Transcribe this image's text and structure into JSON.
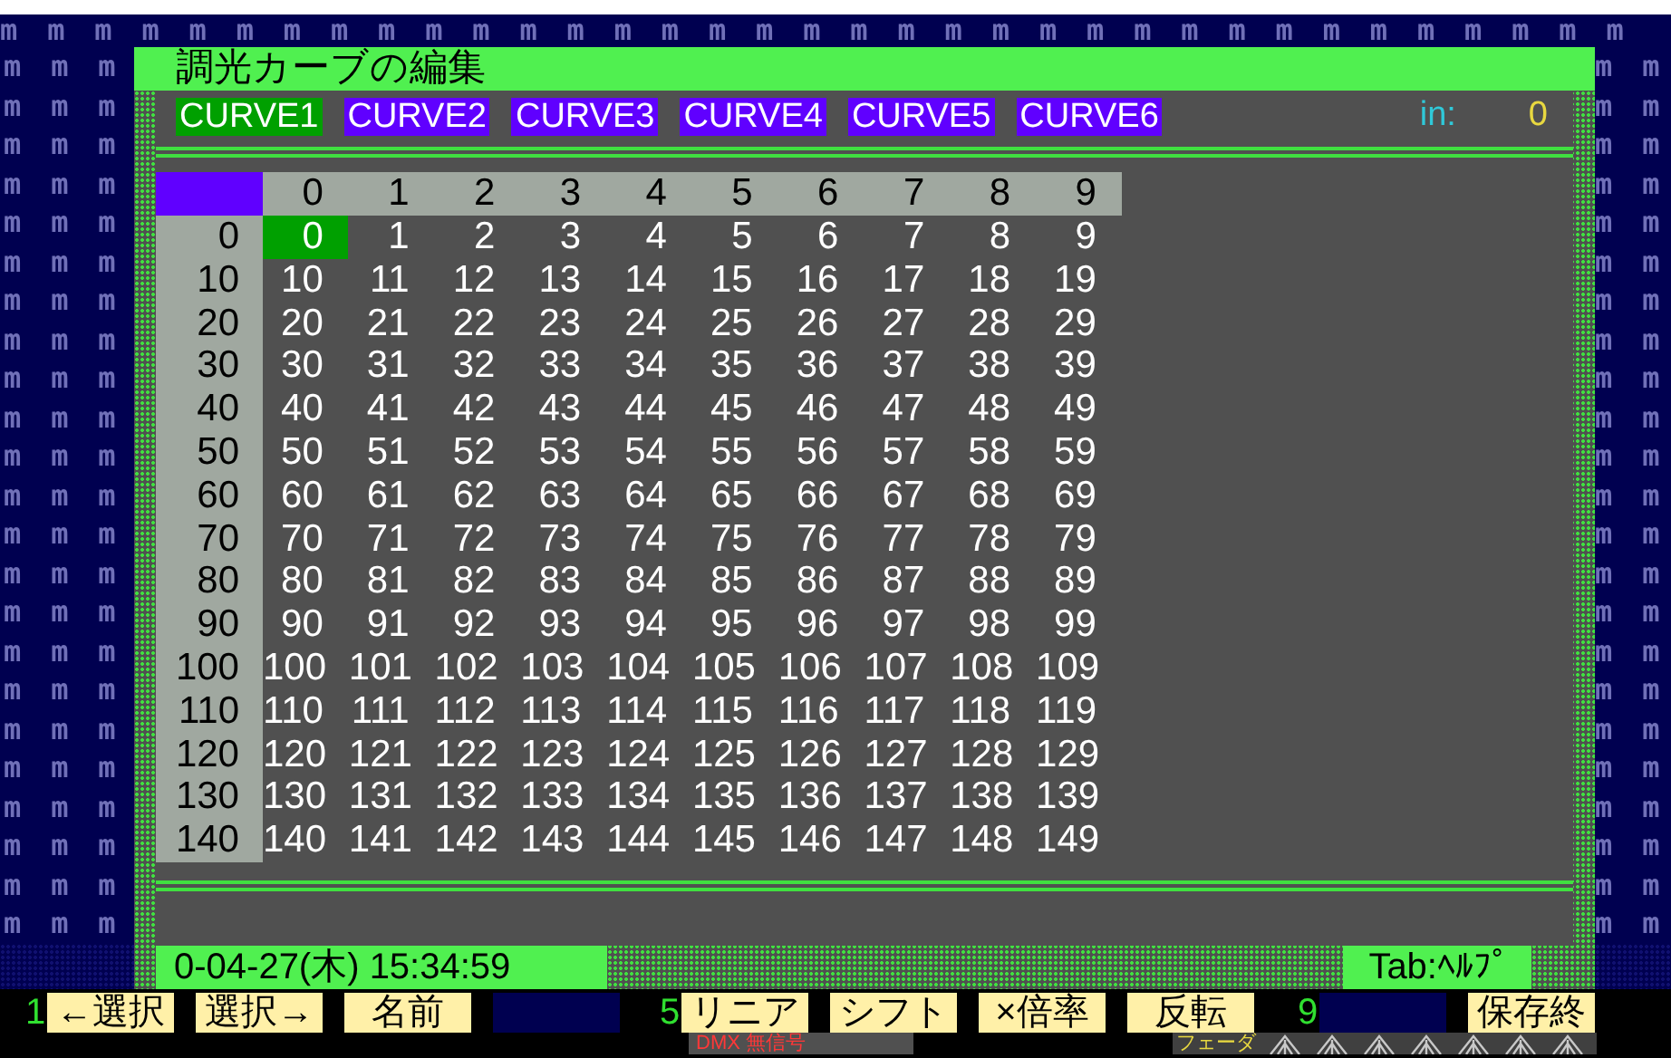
{
  "backdrop": {
    "top_row": "m m m m m m m m m m m m m m m m m m m m m m m m m m m m m m m m m m m",
    "left_rows": [
      "m m m",
      "m m m",
      "m m m",
      "m m m",
      "m m m",
      "m m m",
      "m m m",
      "m m m",
      "m m m",
      "m m m",
      "m m m",
      "m m m",
      "m m m",
      "m m m",
      "m m m",
      "m m m",
      "m m m",
      "m m m",
      "m m m",
      "m m m",
      "m m m",
      "m m m",
      "m m m"
    ],
    "right_rows": [
      "m m",
      "m m",
      "m m",
      "m m",
      "m m",
      "m m",
      "m m",
      "m m",
      "m m",
      "m m",
      "m m",
      "m m",
      "m m",
      "m m",
      "m m",
      "m m",
      "m m",
      "m m",
      "m m",
      "m m",
      "m m",
      "m m",
      "m m"
    ]
  },
  "window": {
    "title": "調光カーブの編集"
  },
  "curves": [
    {
      "label": "CURVE1",
      "selected": true
    },
    {
      "label": "CURVE2",
      "selected": false
    },
    {
      "label": "CURVE3",
      "selected": false
    },
    {
      "label": "CURVE4",
      "selected": false
    },
    {
      "label": "CURVE5",
      "selected": false
    },
    {
      "label": "CURVE6",
      "selected": false
    }
  ],
  "input": {
    "label": "in:",
    "value": "0"
  },
  "table": {
    "columns": [
      "0",
      "1",
      "2",
      "3",
      "4",
      "5",
      "6",
      "7",
      "8",
      "9"
    ],
    "rows": [
      {
        "header": "0",
        "cells": [
          {
            "value": "0",
            "selected": true
          },
          {
            "value": "1",
            "selected": false
          },
          {
            "value": "2",
            "selected": false
          },
          {
            "value": "3",
            "selected": false
          },
          {
            "value": "4",
            "selected": false
          },
          {
            "value": "5",
            "selected": false
          },
          {
            "value": "6",
            "selected": false
          },
          {
            "value": "7",
            "selected": false
          },
          {
            "value": "8",
            "selected": false
          },
          {
            "value": "9",
            "selected": false
          }
        ]
      },
      {
        "header": "10",
        "cells": [
          {
            "value": "10",
            "selected": false
          },
          {
            "value": "11",
            "selected": false
          },
          {
            "value": "12",
            "selected": false
          },
          {
            "value": "13",
            "selected": false
          },
          {
            "value": "14",
            "selected": false
          },
          {
            "value": "15",
            "selected": false
          },
          {
            "value": "16",
            "selected": false
          },
          {
            "value": "17",
            "selected": false
          },
          {
            "value": "18",
            "selected": false
          },
          {
            "value": "19",
            "selected": false
          }
        ]
      },
      {
        "header": "20",
        "cells": [
          {
            "value": "20",
            "selected": false
          },
          {
            "value": "21",
            "selected": false
          },
          {
            "value": "22",
            "selected": false
          },
          {
            "value": "23",
            "selected": false
          },
          {
            "value": "24",
            "selected": false
          },
          {
            "value": "25",
            "selected": false
          },
          {
            "value": "26",
            "selected": false
          },
          {
            "value": "27",
            "selected": false
          },
          {
            "value": "28",
            "selected": false
          },
          {
            "value": "29",
            "selected": false
          }
        ]
      },
      {
        "header": "30",
        "cells": [
          {
            "value": "30",
            "selected": false
          },
          {
            "value": "31",
            "selected": false
          },
          {
            "value": "32",
            "selected": false
          },
          {
            "value": "33",
            "selected": false
          },
          {
            "value": "34",
            "selected": false
          },
          {
            "value": "35",
            "selected": false
          },
          {
            "value": "36",
            "selected": false
          },
          {
            "value": "37",
            "selected": false
          },
          {
            "value": "38",
            "selected": false
          },
          {
            "value": "39",
            "selected": false
          }
        ]
      },
      {
        "header": "40",
        "cells": [
          {
            "value": "40",
            "selected": false
          },
          {
            "value": "41",
            "selected": false
          },
          {
            "value": "42",
            "selected": false
          },
          {
            "value": "43",
            "selected": false
          },
          {
            "value": "44",
            "selected": false
          },
          {
            "value": "45",
            "selected": false
          },
          {
            "value": "46",
            "selected": false
          },
          {
            "value": "47",
            "selected": false
          },
          {
            "value": "48",
            "selected": false
          },
          {
            "value": "49",
            "selected": false
          }
        ]
      },
      {
        "header": "50",
        "cells": [
          {
            "value": "50",
            "selected": false
          },
          {
            "value": "51",
            "selected": false
          },
          {
            "value": "52",
            "selected": false
          },
          {
            "value": "53",
            "selected": false
          },
          {
            "value": "54",
            "selected": false
          },
          {
            "value": "55",
            "selected": false
          },
          {
            "value": "56",
            "selected": false
          },
          {
            "value": "57",
            "selected": false
          },
          {
            "value": "58",
            "selected": false
          },
          {
            "value": "59",
            "selected": false
          }
        ]
      },
      {
        "header": "60",
        "cells": [
          {
            "value": "60",
            "selected": false
          },
          {
            "value": "61",
            "selected": false
          },
          {
            "value": "62",
            "selected": false
          },
          {
            "value": "63",
            "selected": false
          },
          {
            "value": "64",
            "selected": false
          },
          {
            "value": "65",
            "selected": false
          },
          {
            "value": "66",
            "selected": false
          },
          {
            "value": "67",
            "selected": false
          },
          {
            "value": "68",
            "selected": false
          },
          {
            "value": "69",
            "selected": false
          }
        ]
      },
      {
        "header": "70",
        "cells": [
          {
            "value": "70",
            "selected": false
          },
          {
            "value": "71",
            "selected": false
          },
          {
            "value": "72",
            "selected": false
          },
          {
            "value": "73",
            "selected": false
          },
          {
            "value": "74",
            "selected": false
          },
          {
            "value": "75",
            "selected": false
          },
          {
            "value": "76",
            "selected": false
          },
          {
            "value": "77",
            "selected": false
          },
          {
            "value": "78",
            "selected": false
          },
          {
            "value": "79",
            "selected": false
          }
        ]
      },
      {
        "header": "80",
        "cells": [
          {
            "value": "80",
            "selected": false
          },
          {
            "value": "81",
            "selected": false
          },
          {
            "value": "82",
            "selected": false
          },
          {
            "value": "83",
            "selected": false
          },
          {
            "value": "84",
            "selected": false
          },
          {
            "value": "85",
            "selected": false
          },
          {
            "value": "86",
            "selected": false
          },
          {
            "value": "87",
            "selected": false
          },
          {
            "value": "88",
            "selected": false
          },
          {
            "value": "89",
            "selected": false
          }
        ]
      },
      {
        "header": "90",
        "cells": [
          {
            "value": "90",
            "selected": false
          },
          {
            "value": "91",
            "selected": false
          },
          {
            "value": "92",
            "selected": false
          },
          {
            "value": "93",
            "selected": false
          },
          {
            "value": "94",
            "selected": false
          },
          {
            "value": "95",
            "selected": false
          },
          {
            "value": "96",
            "selected": false
          },
          {
            "value": "97",
            "selected": false
          },
          {
            "value": "98",
            "selected": false
          },
          {
            "value": "99",
            "selected": false
          }
        ]
      },
      {
        "header": "100",
        "cells": [
          {
            "value": "100",
            "selected": false
          },
          {
            "value": "101",
            "selected": false
          },
          {
            "value": "102",
            "selected": false
          },
          {
            "value": "103",
            "selected": false
          },
          {
            "value": "104",
            "selected": false
          },
          {
            "value": "105",
            "selected": false
          },
          {
            "value": "106",
            "selected": false
          },
          {
            "value": "107",
            "selected": false
          },
          {
            "value": "108",
            "selected": false
          },
          {
            "value": "109",
            "selected": false
          }
        ]
      },
      {
        "header": "110",
        "cells": [
          {
            "value": "110",
            "selected": false
          },
          {
            "value": "111",
            "selected": false
          },
          {
            "value": "112",
            "selected": false
          },
          {
            "value": "113",
            "selected": false
          },
          {
            "value": "114",
            "selected": false
          },
          {
            "value": "115",
            "selected": false
          },
          {
            "value": "116",
            "selected": false
          },
          {
            "value": "117",
            "selected": false
          },
          {
            "value": "118",
            "selected": false
          },
          {
            "value": "119",
            "selected": false
          }
        ]
      },
      {
        "header": "120",
        "cells": [
          {
            "value": "120",
            "selected": false
          },
          {
            "value": "121",
            "selected": false
          },
          {
            "value": "122",
            "selected": false
          },
          {
            "value": "123",
            "selected": false
          },
          {
            "value": "124",
            "selected": false
          },
          {
            "value": "125",
            "selected": false
          },
          {
            "value": "126",
            "selected": false
          },
          {
            "value": "127",
            "selected": false
          },
          {
            "value": "128",
            "selected": false
          },
          {
            "value": "129",
            "selected": false
          }
        ]
      },
      {
        "header": "130",
        "cells": [
          {
            "value": "130",
            "selected": false
          },
          {
            "value": "131",
            "selected": false
          },
          {
            "value": "132",
            "selected": false
          },
          {
            "value": "133",
            "selected": false
          },
          {
            "value": "134",
            "selected": false
          },
          {
            "value": "135",
            "selected": false
          },
          {
            "value": "136",
            "selected": false
          },
          {
            "value": "137",
            "selected": false
          },
          {
            "value": "138",
            "selected": false
          },
          {
            "value": "139",
            "selected": false
          }
        ]
      },
      {
        "header": "140",
        "cells": [
          {
            "value": "140",
            "selected": false
          },
          {
            "value": "141",
            "selected": false
          },
          {
            "value": "142",
            "selected": false
          },
          {
            "value": "143",
            "selected": false
          },
          {
            "value": "144",
            "selected": false
          },
          {
            "value": "145",
            "selected": false
          },
          {
            "value": "146",
            "selected": false
          },
          {
            "value": "147",
            "selected": false
          },
          {
            "value": "148",
            "selected": false
          },
          {
            "value": "149",
            "selected": false
          }
        ]
      }
    ]
  },
  "status_bar": {
    "clock": "0-04-27(木) 15:34:59",
    "help": "Tab:ﾍﾙﾌﾟ"
  },
  "function_keys": [
    {
      "kind": "key",
      "number": "1",
      "label": "←選択"
    },
    {
      "kind": "key",
      "label": "選択→"
    },
    {
      "kind": "key",
      "label": "名前"
    },
    {
      "kind": "blank"
    },
    {
      "kind": "key",
      "number": "5",
      "label": "リニア"
    },
    {
      "kind": "key",
      "label": "シフト"
    },
    {
      "kind": "key",
      "label": "×倍率"
    },
    {
      "kind": "key",
      "label": "反転"
    },
    {
      "kind": "blank",
      "number": "9"
    },
    {
      "kind": "key",
      "label": "保存終"
    }
  ],
  "bottom_line": {
    "signal": "DMX 無信号",
    "fader_label": "フェーダ"
  }
}
